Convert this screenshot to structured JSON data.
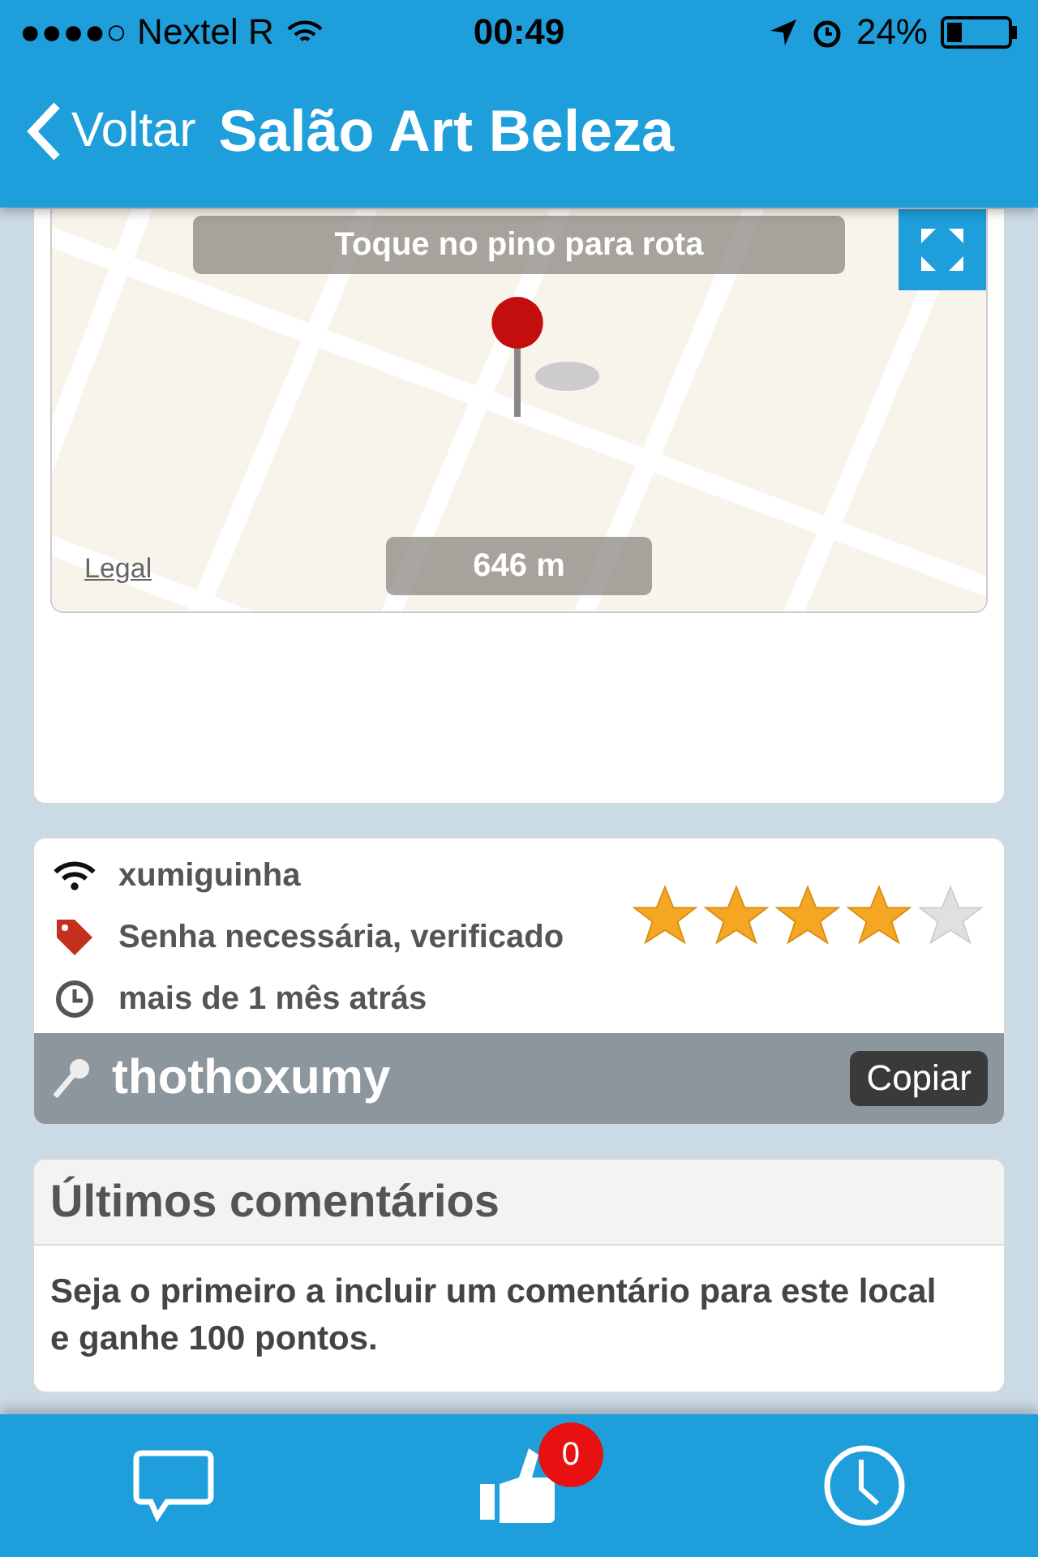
{
  "status_bar": {
    "carrier": "●●●●○ Nextel R",
    "time": "00:49",
    "battery": "24%"
  },
  "nav": {
    "back": "Voltar",
    "title": "Salão Art Beleza"
  },
  "map": {
    "kind": "picture",
    "hint": "Toque no pino para rota",
    "distance": "646 m",
    "legal": "Legal"
  },
  "network": {
    "name": "xumiguinha",
    "security": "Senha necessária, verificado",
    "age": "mais de 1 mês atrás",
    "stars": 4,
    "password": "thothoxumy",
    "copy": "Copiar"
  },
  "comments": {
    "title": "Últimos comentários",
    "text": "Seja o primeiro a incluir um comentário para este local e ganhe 100 pontos."
  },
  "tab_bar": {
    "likes_badge": "0"
  }
}
